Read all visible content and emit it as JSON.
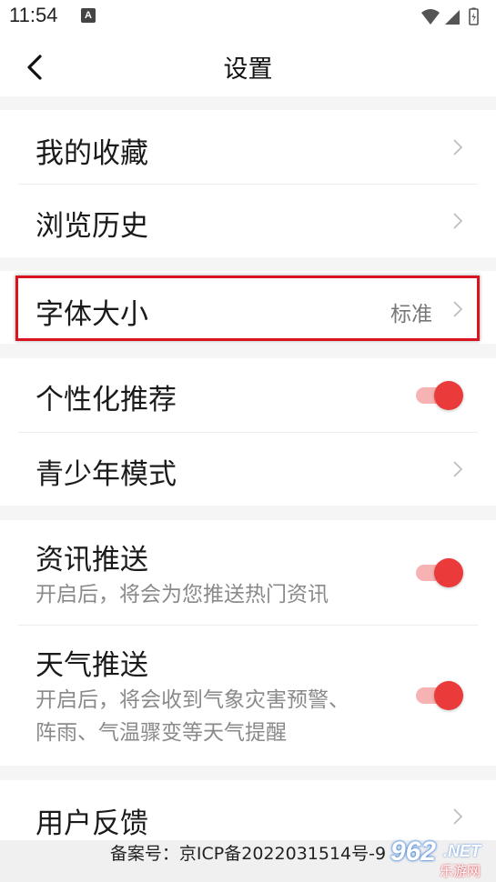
{
  "status_bar": {
    "time": "11:54",
    "notification_letter": "A",
    "icons": [
      "wifi-icon",
      "signal-icon",
      "battery-icon"
    ]
  },
  "header": {
    "title": "设置",
    "back_icon": "chevron-left-icon"
  },
  "groups": [
    {
      "items": [
        {
          "label": "我的收藏",
          "control": "chevron"
        },
        {
          "label": "浏览历史",
          "control": "chevron"
        }
      ]
    },
    {
      "items": [
        {
          "label": "字体大小",
          "value": "标准",
          "control": "chevron",
          "highlighted": true
        }
      ]
    },
    {
      "items": [
        {
          "label": "个性化推荐",
          "control": "toggle",
          "on": true
        },
        {
          "label": "青少年模式",
          "control": "chevron"
        }
      ]
    },
    {
      "items": [
        {
          "label": "资讯推送",
          "subtitle": "开启后，将会为您推送热门资讯",
          "control": "toggle",
          "on": true
        },
        {
          "label": "天气推送",
          "subtitle_line1": "开启后，将会收到气象灾害预警、",
          "subtitle_line2": "阵雨、气温骤变等天气提醒",
          "control": "toggle",
          "on": true
        }
      ]
    },
    {
      "items": [
        {
          "label": "用户反馈",
          "control": "chevron"
        }
      ]
    }
  ],
  "footer": {
    "icp": "备案号：京ICP备2022031514号-9"
  },
  "watermark": {
    "num": "962",
    "net": ".NET",
    "cn": "乐游网"
  },
  "colors": {
    "accent": "#ea3a3a",
    "toggle_track": "#f7b3b3",
    "highlight_border": "#d9141f",
    "background": "#f5f5f5"
  }
}
